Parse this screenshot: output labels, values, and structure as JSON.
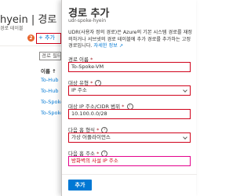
{
  "background_page": {
    "title": "hyein | 경로",
    "subtitle": "경로 테이블",
    "step_number": "2",
    "add_button": "+ 추가",
    "search_placeholder": "경로 필터링",
    "column_header": "이름 ↑",
    "routes": [
      "To-Hub",
      "To-Hub",
      "To-Spoke",
      "To-Spoke"
    ]
  },
  "panel": {
    "title": "경로 추가",
    "subtitle": "udr-spoke-hyein",
    "description": "UDR(사용자 정의 경로)은 Azure의 기본 시스템 경로를 재정의하거나 서브넷의 경로 테이블에 추가 경로를 추가하는 고정 경로입니다.",
    "learn_more": "자세한 정보 ↗",
    "fields": {
      "route_name": {
        "label": "경로 이름",
        "value": "To-Spoke-VM"
      },
      "dest_type": {
        "label": "대상 유형",
        "value": "IP 주소"
      },
      "dest_ip": {
        "label": "대상 IP 주소/CIDR 범위",
        "value": "10.100.0.0/28"
      },
      "next_hop_type": {
        "label": "다음 홉 형식",
        "value": "가상 어플라이언스"
      },
      "next_hop_addr": {
        "label": "다음 홉 주소",
        "value": "방화벽의 사설 IP 주소"
      }
    },
    "submit_label": "추가"
  },
  "colors": {
    "accent": "#0078d4",
    "highlight_red": "#d0021b",
    "highlight_pink": "#e3008c",
    "step_badge": "#e8632a"
  }
}
